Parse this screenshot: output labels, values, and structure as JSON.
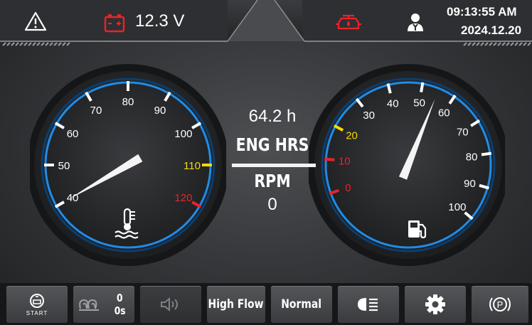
{
  "status_bar": {
    "warning_icon": "warning-triangle-icon",
    "battery_icon": "battery-icon",
    "battery_color": "#e8242a",
    "voltage": "12.3 V",
    "engine_icon": "engine-oil-pressure-icon",
    "engine_icon_color": "#e8242a",
    "operator_icon": "operator-person-icon",
    "time": "09:13:55 AM",
    "date": "2024.12.20"
  },
  "temperature_gauge": {
    "ticks": [
      "40",
      "50",
      "60",
      "70",
      "80",
      "90",
      "100",
      "110",
      "120"
    ],
    "tick_colors": [
      "#ffffff",
      "#ffffff",
      "#ffffff",
      "#ffffff",
      "#ffffff",
      "#ffffff",
      "#ffffff",
      "#f5d90a",
      "#e8242a"
    ],
    "needle_value": 40,
    "icon": "coolant-temperature-icon"
  },
  "fuel_gauge": {
    "ticks": [
      "0",
      "10",
      "20",
      "30",
      "40",
      "50",
      "60",
      "70",
      "80",
      "90",
      "100"
    ],
    "tick_colors": [
      "#e8242a",
      "#e8242a",
      "#f5d90a",
      "#ffffff",
      "#ffffff",
      "#ffffff",
      "#ffffff",
      "#ffffff",
      "#ffffff",
      "#ffffff",
      "#ffffff"
    ],
    "needle_value": 55,
    "icon": "fuel-pump-icon"
  },
  "center": {
    "engine_hours": "64.2 h",
    "engine_hours_label": "ENG HRS",
    "rpm_label": "RPM",
    "rpm_value": "0"
  },
  "buttons": {
    "start_label": "START",
    "glow_count": "0",
    "glow_time": "0s",
    "high_flow": "High Flow",
    "mode": "Normal"
  },
  "colors": {
    "accent_blue": "#1f8ce8",
    "warning_yellow": "#f5d90a",
    "alert_red": "#e8242a"
  }
}
